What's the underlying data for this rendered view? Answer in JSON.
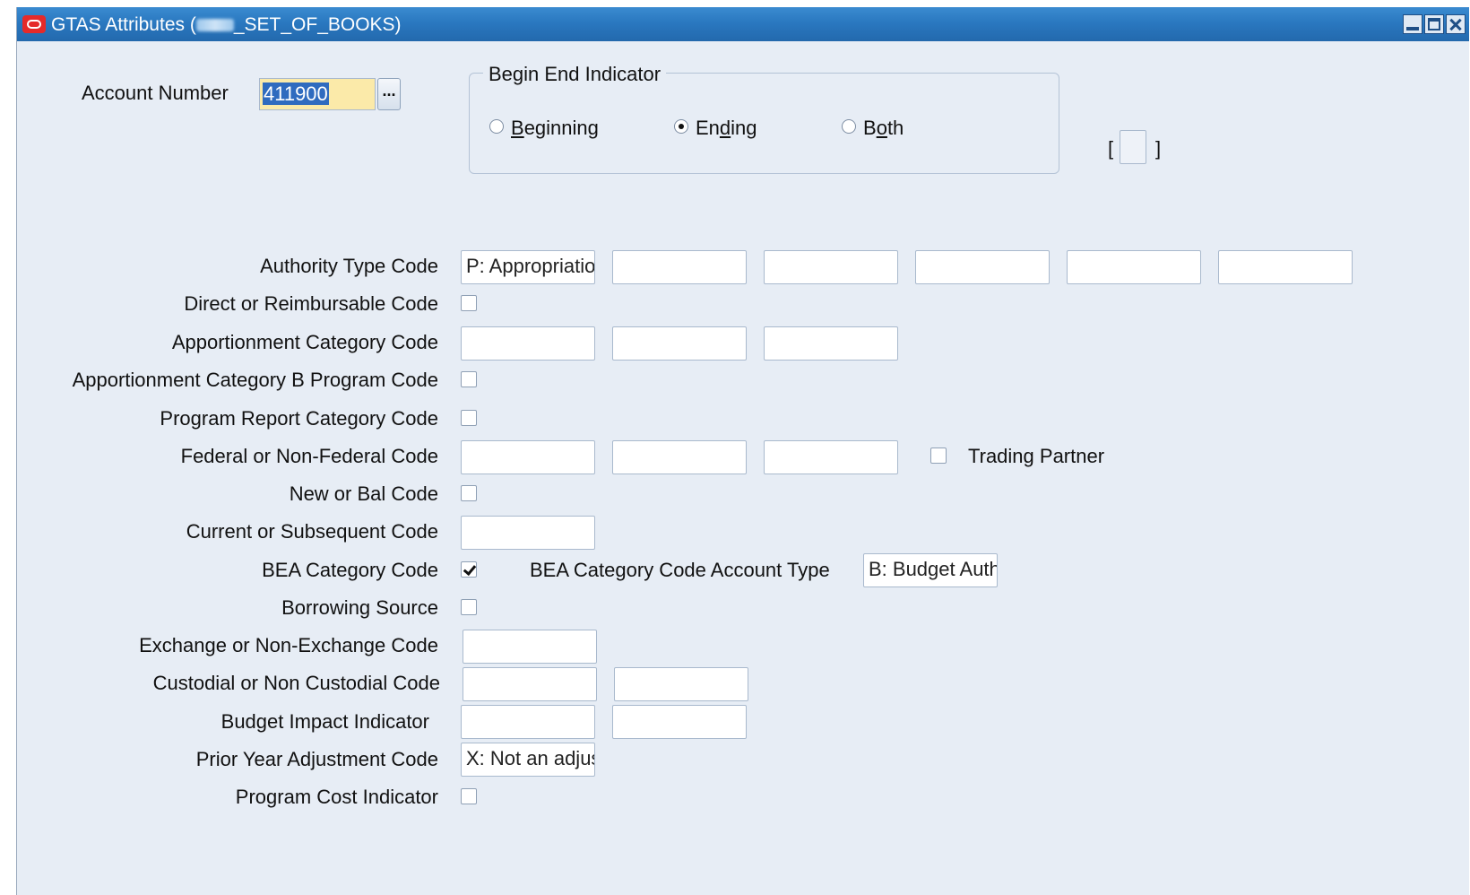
{
  "window": {
    "title_prefix": "GTAS Attributes (",
    "title_suffix": "_SET_OF_BOOKS)"
  },
  "account_number": {
    "label": "Account Number",
    "value": "411900",
    "lov_label": "..."
  },
  "begin_end_indicator": {
    "legend": "Begin End Indicator",
    "options": [
      {
        "pre": "",
        "acc": "B",
        "post": "eginning",
        "selected": false
      },
      {
        "pre": "En",
        "acc": "d",
        "post": "ing",
        "selected": true
      },
      {
        "pre": "B",
        "acc": "o",
        "post": "th",
        "selected": false
      }
    ]
  },
  "bracket": {
    "open": "[",
    "close": "]"
  },
  "attributes": {
    "authority_type_code": {
      "label": "Authority Type Code",
      "values": [
        "P: Appropriation",
        "",
        "",
        "",
        "",
        ""
      ]
    },
    "direct_or_reimbursable_code": {
      "label": "Direct or Reimbursable Code",
      "checked": false
    },
    "apportionment_category_code": {
      "label": "Apportionment Category Code",
      "values": [
        "",
        "",
        ""
      ]
    },
    "apportionment_category_b_program_code": {
      "label": "Apportionment Category B Program Code",
      "checked": false
    },
    "program_report_category_code": {
      "label": "Program Report Category Code",
      "checked": false
    },
    "federal_or_non_federal_code": {
      "label": "Federal or Non-Federal Code",
      "values": [
        "",
        "",
        ""
      ]
    },
    "trading_partner": {
      "label": "Trading Partner",
      "checked": false
    },
    "new_or_bal_code": {
      "label": "New or Bal Code",
      "checked": false
    },
    "current_or_subsequent_code": {
      "label": "Current or Subsequent Code",
      "values": [
        ""
      ]
    },
    "bea_category_code": {
      "label": "BEA Category Code",
      "checked": true
    },
    "bea_category_code_account_type": {
      "label": "BEA Category Code Account Type",
      "value": "B: Budget Authority"
    },
    "borrowing_source": {
      "label": "Borrowing Source",
      "checked": false
    },
    "exchange_or_non_exchange_code": {
      "label": "Exchange or Non-Exchange Code",
      "values": [
        ""
      ]
    },
    "custodial_or_non_custodial_code": {
      "label": "Custodial or Non Custodial Code",
      "values": [
        "",
        ""
      ]
    },
    "budget_impact_indicator": {
      "label": "Budget Impact Indicator",
      "values": [
        "",
        ""
      ]
    },
    "prior_year_adjustment_code": {
      "label": "Prior Year Adjustment Code",
      "values": [
        "X: Not an adjustment"
      ]
    },
    "program_cost_indicator": {
      "label": "Program Cost Indicator",
      "checked": false
    }
  },
  "colors": {
    "titlebar": "#2a78c0",
    "background": "#e7edf5",
    "focused_field": "#fbeaa9",
    "selection": "#2f6bbf"
  }
}
